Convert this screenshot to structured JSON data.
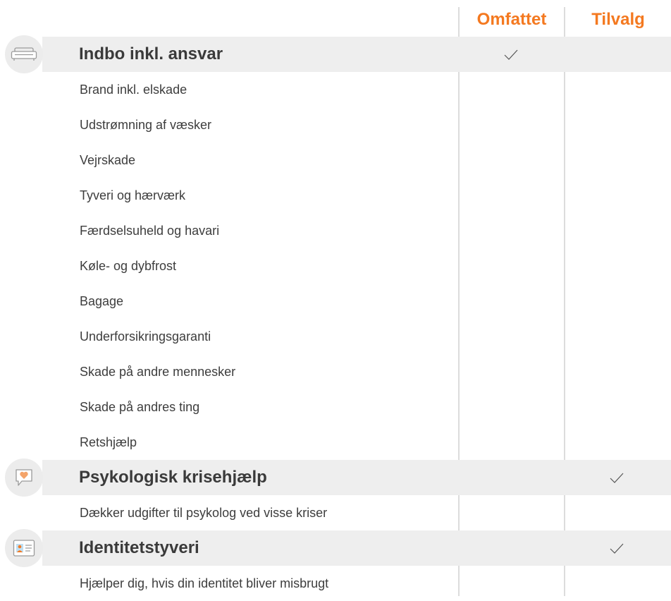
{
  "columns": {
    "included": "Omfattet",
    "optional": "Tilvalg"
  },
  "sections": [
    {
      "title": "Indbo inkl. ansvar",
      "icon": "sofa-icon",
      "included": true,
      "optional": false,
      "items": [
        "Brand inkl. elskade",
        "Udstrømning af væsker",
        "Vejrskade",
        "Tyveri og hærværk",
        "Færdselsuheld og havari",
        "Køle- og dybfrost",
        "Bagage",
        "Underforsikringsgaranti",
        "Skade på andre mennesker",
        "Skade på andres ting",
        "Retshjælp"
      ]
    },
    {
      "title": "Psykologisk krisehjælp",
      "icon": "speech-heart-icon",
      "included": false,
      "optional": true,
      "items": [
        "Dækker udgifter til psykolog ved visse kriser"
      ]
    },
    {
      "title": "Identitetstyveri",
      "icon": "id-card-icon",
      "included": false,
      "optional": true,
      "items": [
        "Hjælper dig, hvis din identitet bliver misbrugt"
      ]
    }
  ],
  "colors": {
    "accent": "#f47920",
    "band": "#eeeeee",
    "divider": "#dcdcdc"
  }
}
